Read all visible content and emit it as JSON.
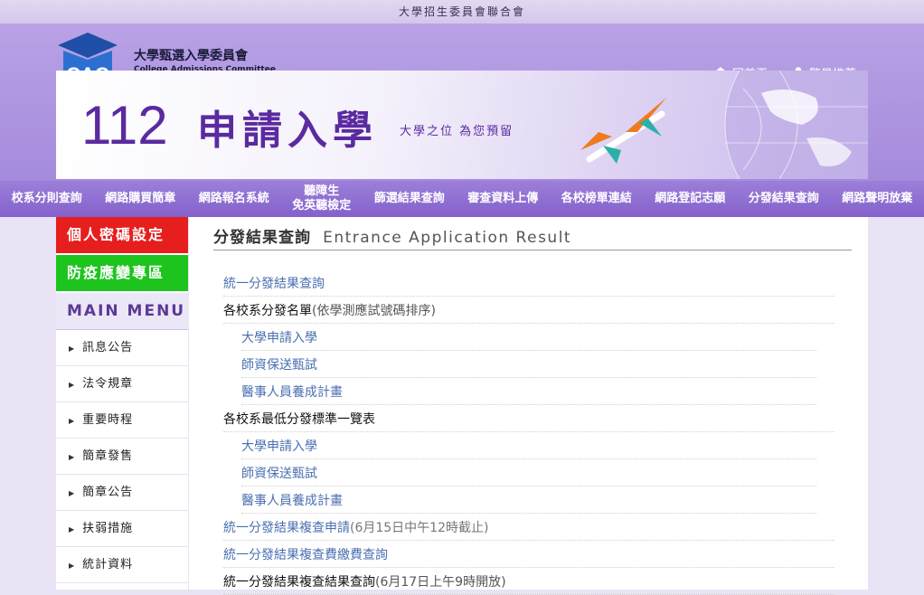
{
  "topbar": {
    "text": "大學招生委員會聯合會"
  },
  "logo": {
    "cn": "大學甄選入學委員會",
    "en": "College Admissions Committee",
    "mark": "CAC"
  },
  "toplinks": [
    {
      "label": "回首頁",
      "icon": "home-icon"
    },
    {
      "label": "繁星推薦",
      "icon": "user-icon"
    }
  ],
  "banner": {
    "number": "112",
    "title": "申請入學",
    "slogan": "大學之位 為您預留"
  },
  "nav": [
    "校系分則查詢",
    "網路購買簡章",
    "網路報名系統",
    "聽障生",
    "免英聽檢定",
    "篩選結果查詢",
    "審查資料上傳",
    "各校榜單連結",
    "網路登記志願",
    "分發結果查詢",
    "網路聲明放棄"
  ],
  "sidebar": {
    "password": "個人密碼設定",
    "epidemic": "防疫應變專區",
    "menu_title": "MAIN MENU",
    "items": [
      "訊息公告",
      "法令規章",
      "重要時程",
      "簡章發售",
      "簡章公告",
      "扶弱措施",
      "統計資料"
    ]
  },
  "content": {
    "title_cn": "分發結果查詢",
    "title_en": "Entrance Application Result",
    "rows": [
      {
        "text": "統一分發結果查詢",
        "note": ""
      },
      {
        "text": "各校系分發名單",
        "note": "(依學測應試號碼排序)"
      },
      {
        "text": "大學申請入學",
        "note": ""
      },
      {
        "text": "師資保送甄試",
        "note": ""
      },
      {
        "text": "醫事人員養成計畫",
        "note": ""
      },
      {
        "text": "各校系最低分發標準一覽表",
        "note": ""
      },
      {
        "text": "大學申請入學",
        "note": ""
      },
      {
        "text": "師資保送甄試",
        "note": ""
      },
      {
        "text": "醫事人員養成計畫",
        "note": ""
      },
      {
        "text": "統一分發結果複查申請",
        "note": "(6月15日中午12時截止)"
      },
      {
        "text": "統一分發結果複查費繳費查詢",
        "note": ""
      },
      {
        "text": "統一分發結果複查結果查詢",
        "note": "(6月17日上午9時開放)"
      }
    ]
  },
  "colors": {
    "purple": "#8461cc",
    "accent": "#5b2aa0",
    "red": "#e61e1e",
    "green": "#1ec41e",
    "link": "#4a6fb0"
  }
}
